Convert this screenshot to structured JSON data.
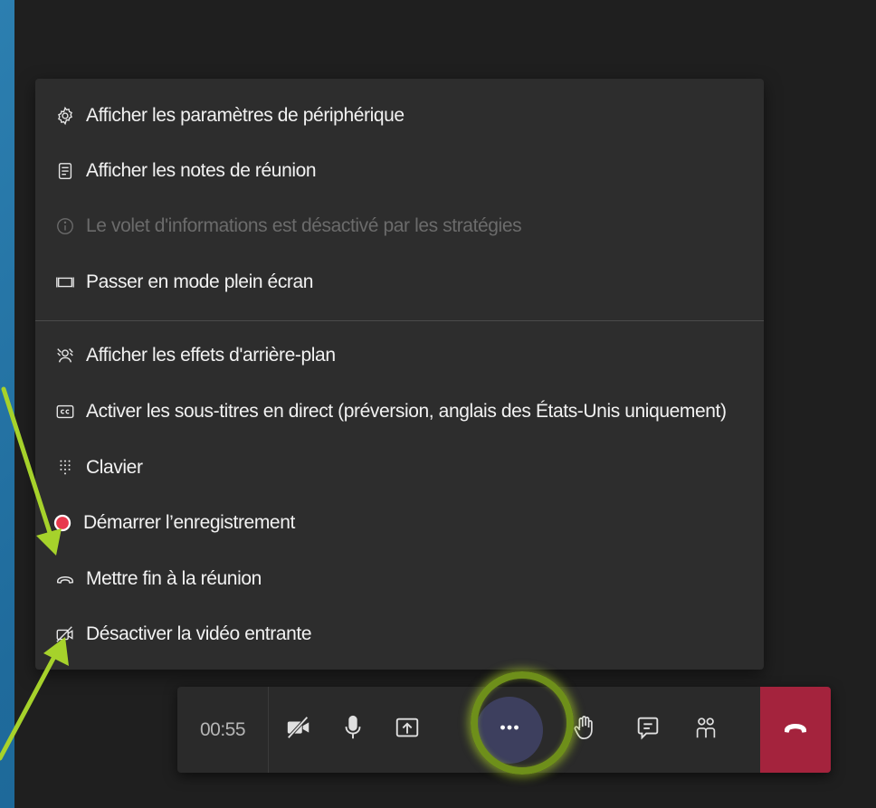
{
  "menu": {
    "items": [
      {
        "label": "Afficher les paramètres de périphérique",
        "icon": "gear-icon",
        "disabled": false
      },
      {
        "label": "Afficher les notes de réunion",
        "icon": "notes-icon",
        "disabled": false
      },
      {
        "label": "Le volet d'informations est désactivé par les stratégies",
        "icon": "info-icon",
        "disabled": true
      },
      {
        "label": "Passer en mode plein écran",
        "icon": "fullscreen-icon",
        "disabled": false
      },
      {
        "label": "Afficher les effets d'arrière-plan",
        "icon": "background-effects-icon",
        "disabled": false
      },
      {
        "label": "Activer les sous-titres en direct (préversion, anglais des États-Unis uniquement)",
        "icon": "captions-icon",
        "disabled": false
      },
      {
        "label": "Clavier",
        "icon": "dialpad-icon",
        "disabled": false
      },
      {
        "label": "Démarrer l’enregistrement",
        "icon": "record-icon",
        "disabled": false
      },
      {
        "label": "Mettre fin à la réunion",
        "icon": "end-call-icon",
        "disabled": false
      },
      {
        "label": "Désactiver la vidéo entrante",
        "icon": "video-off-icon",
        "disabled": false
      }
    ]
  },
  "toolbar": {
    "timer": "00:55",
    "buttons": [
      {
        "icon": "camera-off-icon"
      },
      {
        "icon": "microphone-icon"
      },
      {
        "icon": "share-screen-icon"
      },
      {
        "icon": "more-options-icon"
      },
      {
        "icon": "raise-hand-icon"
      },
      {
        "icon": "chat-icon"
      },
      {
        "icon": "participants-icon"
      },
      {
        "icon": "hang-up-icon"
      }
    ]
  },
  "colors": {
    "menu_bg": "#2d2d2d",
    "toolbar_bg": "#2a2a2a",
    "hangup_red": "#a4233d",
    "record_red": "#e8394d",
    "highlight_green": "#a6d22b",
    "page_blue": "#1f6b9c"
  }
}
